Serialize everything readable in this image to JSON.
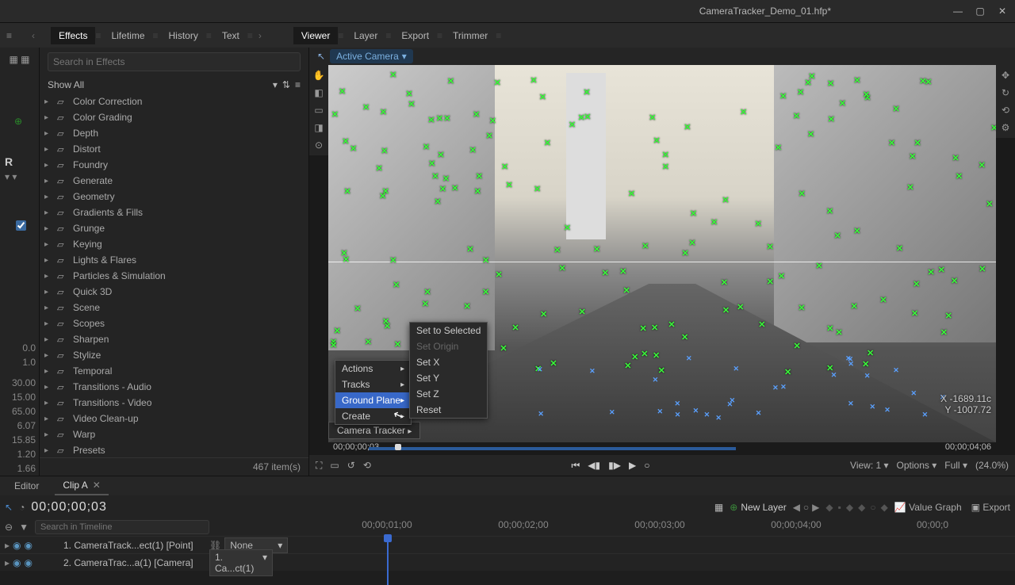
{
  "title": "CameraTracker_Demo_01.hfp*",
  "menubar": {
    "left": [
      "Effects",
      "Lifetime",
      "History",
      "Text"
    ],
    "right": [
      "Viewer",
      "Layer",
      "Export",
      "Trimmer"
    ],
    "active_left": "Effects",
    "active_right": "Viewer"
  },
  "effects": {
    "search_placeholder": "Search in Effects",
    "show_all": "Show All",
    "categories": [
      "Color Correction",
      "Color Grading",
      "Depth",
      "Distort",
      "Foundry",
      "Generate",
      "Geometry",
      "Gradients & Fills",
      "Grunge",
      "Keying",
      "Lights & Flares",
      "Particles & Simulation",
      "Quick 3D",
      "Scene",
      "Scopes",
      "Sharpen",
      "Stylize",
      "Temporal",
      "Transitions - Audio",
      "Transitions - Video",
      "Video Clean-up",
      "Warp",
      "Presets"
    ],
    "item_count": "467 item(s)"
  },
  "left_rail": {
    "numbers": [
      "0.0",
      "1.0",
      "30.00",
      "15.00",
      "65.00",
      "6.07",
      "15.85",
      "1.20",
      "1.66"
    ],
    "label": "R"
  },
  "viewer": {
    "camera_label": "Active Camera",
    "timecode": "00;00;00;03",
    "end_timecode": "00;00;04;06",
    "coord_x": "X   -1689.11c",
    "coord_y": "Y   -1007.72",
    "view_label": "View: 1",
    "options_label": "Options",
    "full_label": "Full",
    "zoom_label": "(24.0%)"
  },
  "context_menu": {
    "title": "Camera Tracker",
    "items": [
      "Actions",
      "Tracks",
      "Ground Plane",
      "Create"
    ],
    "highlighted": "Ground Plane",
    "submenu": [
      "Set to Selected",
      "Set Origin",
      "Set X",
      "Set Y",
      "Set Z",
      "Reset"
    ],
    "submenu_disabled": "Set Origin"
  },
  "timeline": {
    "tabs": {
      "editor": "Editor",
      "clip": "Clip A"
    },
    "big_timecode": "00;00;00;03",
    "search_placeholder": "Search in Timeline",
    "new_layer": "New Layer",
    "value_graph": "Value Graph",
    "export": "Export",
    "ruler": [
      "00;00;01;00",
      "00;00;02;00",
      "00;00;03;00",
      "00;00;04;00",
      "00;00;0"
    ],
    "tracks": [
      {
        "name": "1. CameraTrack...ect(1) [Point]",
        "dd": "None"
      },
      {
        "name": "2. CameraTrac...a(1) [Camera]",
        "dd": "1. Ca...ct(1)"
      }
    ]
  }
}
